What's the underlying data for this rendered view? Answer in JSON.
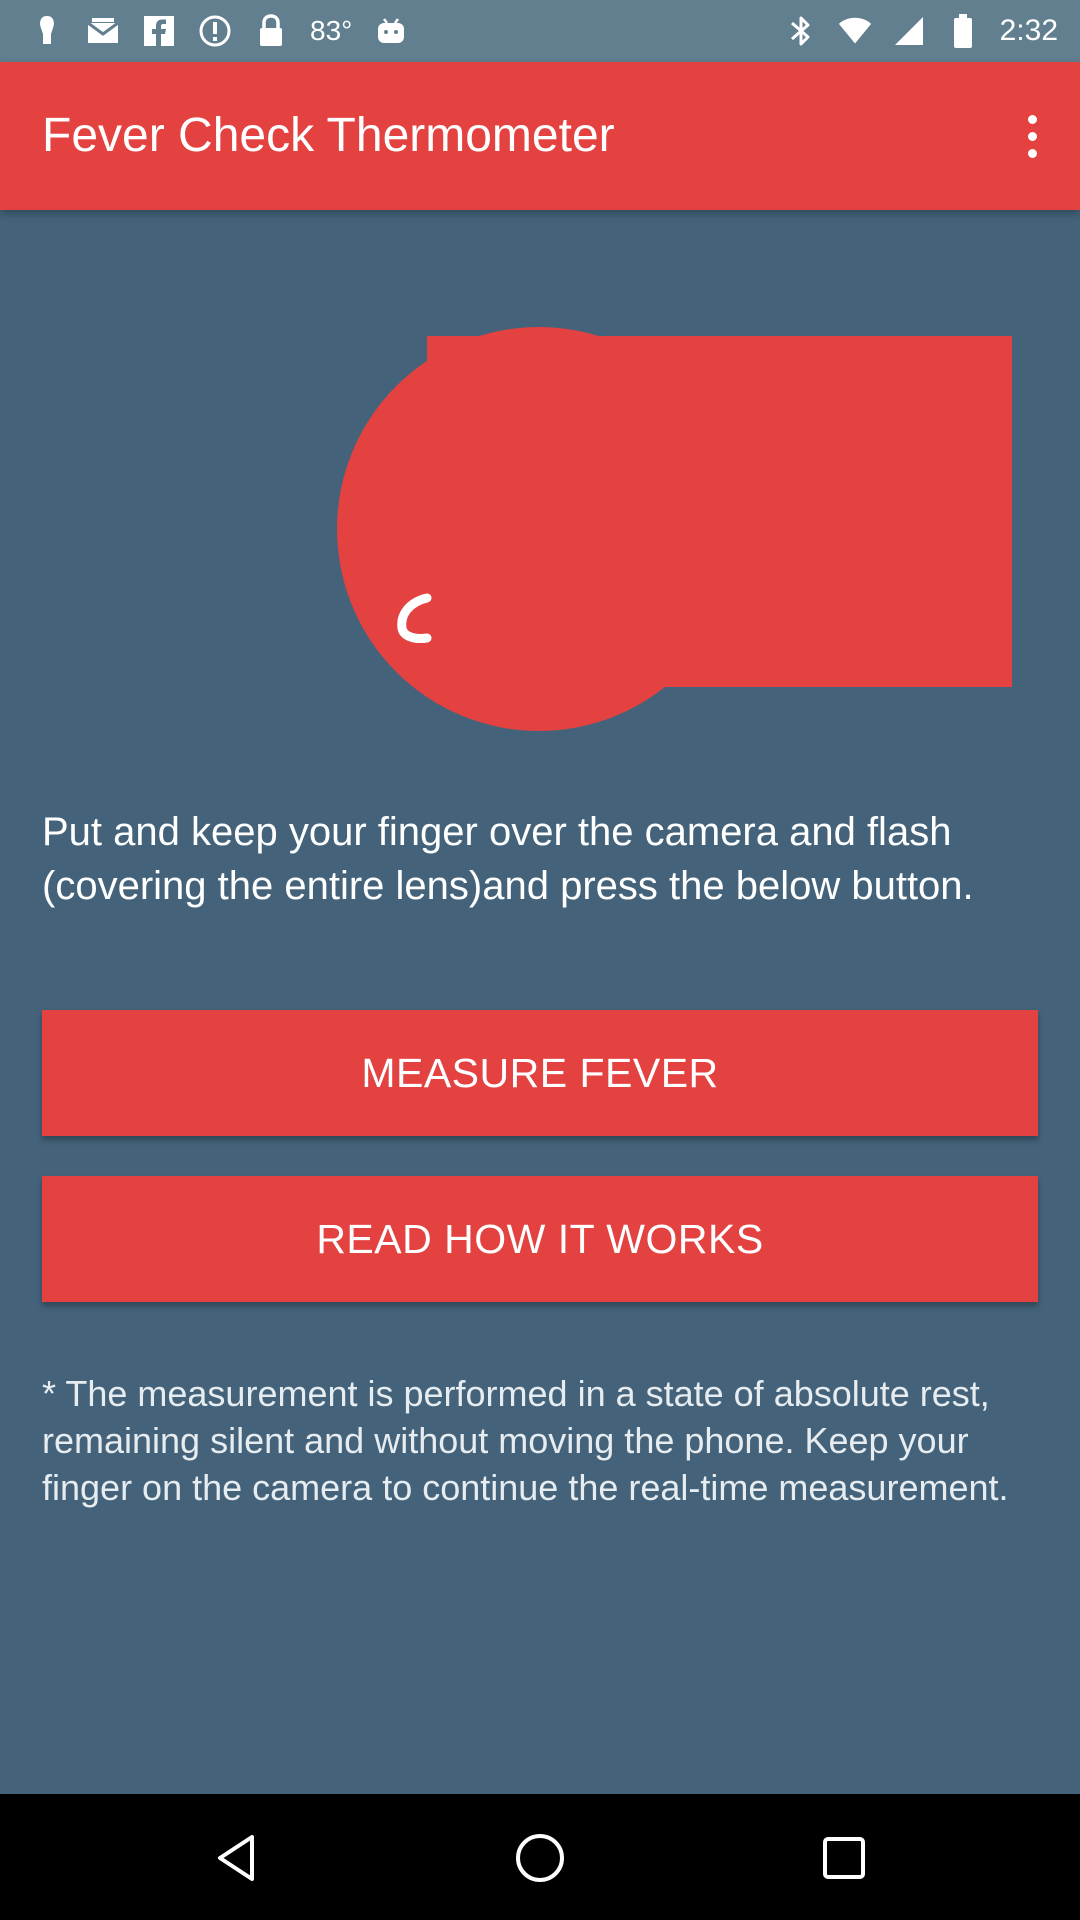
{
  "status_bar": {
    "temperature": "83°",
    "time": "2:32",
    "left_icons": [
      "notification-icon",
      "mail-icon",
      "facebook-icon",
      "alert-icon",
      "lock-icon",
      "temperature-text",
      "android-icon"
    ],
    "right_icons": [
      "bluetooth-icon",
      "wifi-icon",
      "signal-icon",
      "battery-icon"
    ]
  },
  "app_bar": {
    "title": "Fever Check Thermometer",
    "overflow_icon": "more-vert-icon"
  },
  "main": {
    "instruction": "Put and keep your finger over the camera and flash (covering the entire lens)and press the below button.",
    "measure_button": "MEASURE FEVER",
    "read_button": "READ HOW IT WORKS",
    "note": "* The measurement is performed in a state of absolute rest, remaining silent and without moving the phone. Keep your finger on the camera to continue the real-time measurement."
  },
  "nav_bar": {
    "back": "back-icon",
    "home": "home-icon",
    "recents": "recents-icon"
  },
  "colors": {
    "accent": "#e44141",
    "background": "#44637a",
    "status_bar": "#617f8f",
    "nav_bar": "#000000"
  }
}
